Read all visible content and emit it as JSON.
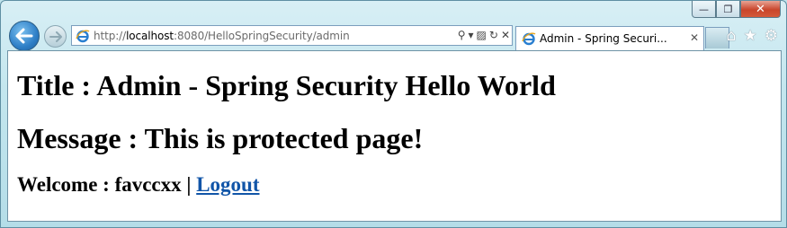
{
  "browser": {
    "url_prefix": "http://",
    "url_host": "localhost",
    "url_rest": ":8080/HelloSpringSecurity/admin",
    "tab_title": "Admin - Spring Securi...",
    "icons": [
      "back-arrow-icon",
      "forward-arrow-icon",
      "ie-logo-icon",
      "search-icon",
      "dropdown-icon",
      "compat-view-icon",
      "refresh-icon",
      "stop-icon",
      "home-icon",
      "favorites-star-icon",
      "settings-gear-icon"
    ]
  },
  "window": {
    "minimize": "—",
    "restore": "❐",
    "close": "✕"
  },
  "page": {
    "title_label": "Title : Admin - Spring Security Hello World",
    "message_label": "Message : This is protected page!",
    "welcome_prefix": "Welcome : favccxx | ",
    "logout_text": "Logout"
  },
  "colors": {
    "link": "#1155a8",
    "chrome": "#c3e6ee",
    "close_button": "#c9462c"
  }
}
